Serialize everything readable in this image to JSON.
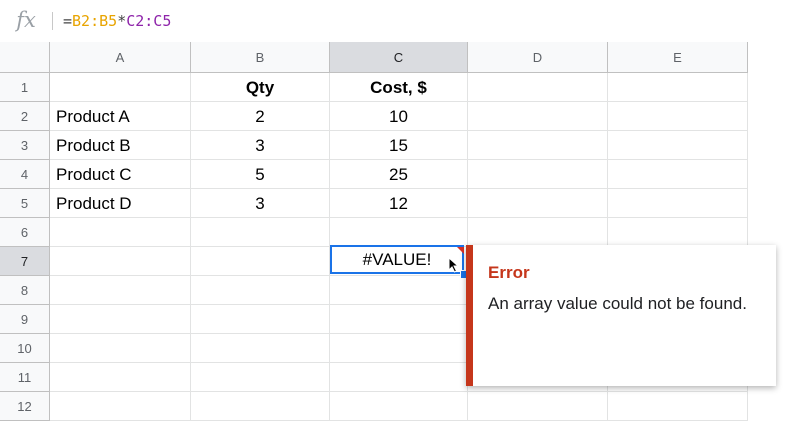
{
  "formula_bar": {
    "fx_label": "fx",
    "formula_parts": [
      {
        "text": "=",
        "color": "#444444"
      },
      {
        "text": "B2:B5",
        "color": "#e8a400"
      },
      {
        "text": "*",
        "color": "#444444"
      },
      {
        "text": "C2:C5",
        "color": "#8e24aa"
      }
    ]
  },
  "columns": [
    "A",
    "B",
    "C",
    "D",
    "E"
  ],
  "selected_column": "C",
  "rows": [
    "1",
    "2",
    "3",
    "4",
    "5",
    "6",
    "7",
    "8",
    "9",
    "10",
    "11",
    "12"
  ],
  "selected_row": "7",
  "cells": {
    "B1": "Qty",
    "C1": "Cost, $",
    "A2": "Product A",
    "B2": "2",
    "C2": "10",
    "A3": "Product B",
    "B3": "3",
    "C3": "15",
    "A4": "Product C",
    "B4": "5",
    "C4": "25",
    "A5": "Product D",
    "B5": "3",
    "C5": "12"
  },
  "active_cell": {
    "ref": "C7",
    "value": "#VALUE!"
  },
  "error_tooltip": {
    "title": "Error",
    "message": "An array value could not be found.",
    "accent_color": "#c5361b"
  },
  "colors": {
    "selection_blue": "#1a73e8",
    "header_bg": "#f8f9fa",
    "header_selected_bg": "#dadce0"
  }
}
